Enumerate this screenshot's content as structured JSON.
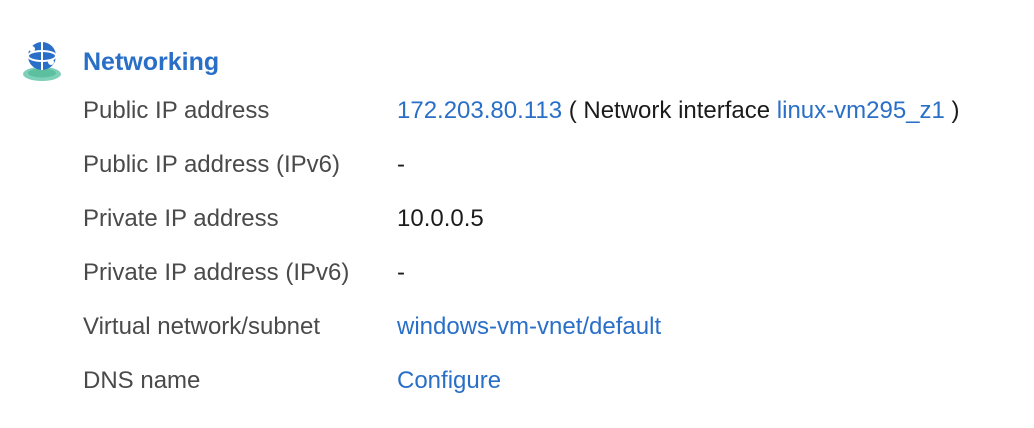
{
  "section": {
    "title": "Networking",
    "icon": "networking-globe-icon"
  },
  "rows": [
    {
      "label": "Public IP address",
      "ip_link": "172.203.80.113",
      "paren_open": " ( ",
      "nic_prefix": "Network interface ",
      "nic_link": "linux-vm295_z1",
      "paren_close": " )"
    },
    {
      "label": "Public IP address (IPv6)",
      "value": "-"
    },
    {
      "label": "Private IP address",
      "value": "10.0.0.5"
    },
    {
      "label": "Private IP address (IPv6)",
      "value": "-"
    },
    {
      "label": "Virtual network/subnet",
      "link": "windows-vm-vnet/default"
    },
    {
      "label": "DNS name",
      "link": "Configure"
    }
  ],
  "colors": {
    "link": "#2a6fc7",
    "label": "#4a4a4a",
    "value": "#1b1b1b",
    "icon_globe": "#2a6fc7",
    "icon_base": "#7fd0b8"
  }
}
